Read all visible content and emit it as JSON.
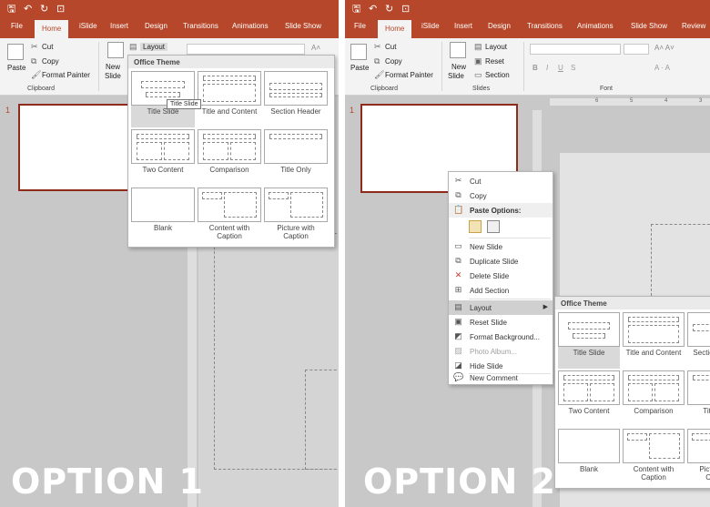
{
  "qat": {
    "save_icon": "save-icon",
    "undo_icon": "undo-icon",
    "redo_icon": "redo-icon",
    "present_icon": "present-icon"
  },
  "tabs_p1": [
    "File",
    "Home",
    "iSlide",
    "Insert",
    "Design",
    "Transitions",
    "Animations",
    "Slide Show"
  ],
  "tabs_p2": [
    "File",
    "Home",
    "iSlide",
    "Insert",
    "Design",
    "Transitions",
    "Animations",
    "Slide Show",
    "Review"
  ],
  "ribbon": {
    "paste": "Paste",
    "cut": "Cut",
    "copy": "Copy",
    "format_painter": "Format Painter",
    "clipboard": "Clipboard",
    "new_slide": "New",
    "new_slide_2": "Slide",
    "layout": "Layout",
    "reset": "Reset",
    "section": "Section",
    "slides": "Slides",
    "font": "Font"
  },
  "slide_number": "1",
  "gallery": {
    "header": "Office Theme",
    "layouts": [
      "Title Slide",
      "Title and Content",
      "Section Header",
      "Two Content",
      "Comparison",
      "Title Only",
      "Blank",
      "Content with Caption",
      "Picture with Caption"
    ],
    "tooltip": "Title Slide"
  },
  "gallery2": {
    "header": "Office Theme",
    "layouts": [
      "Title Slide",
      "Title and Content",
      "Section Header",
      "Two Content",
      "Comparison",
      "Title Only",
      "Blank",
      "Content with Caption",
      "Picture with Caption"
    ]
  },
  "context_menu": {
    "items": [
      "Cut",
      "Copy",
      "Paste Options:",
      "New Slide",
      "Duplicate Slide",
      "Delete Slide",
      "Add Section",
      "Layout",
      "Reset Slide",
      "Format Background...",
      "Photo Album...",
      "Hide Slide",
      "New Comment"
    ]
  },
  "ruler": {
    "marks": [
      "6",
      "5",
      "4",
      "3"
    ]
  },
  "captions": {
    "option1": "OPTION 1",
    "option2": "OPTION 2"
  },
  "colors": {
    "accent": "#b7472a",
    "ribbon": "#f3f3f3",
    "workspace": "#c8c8c8"
  }
}
